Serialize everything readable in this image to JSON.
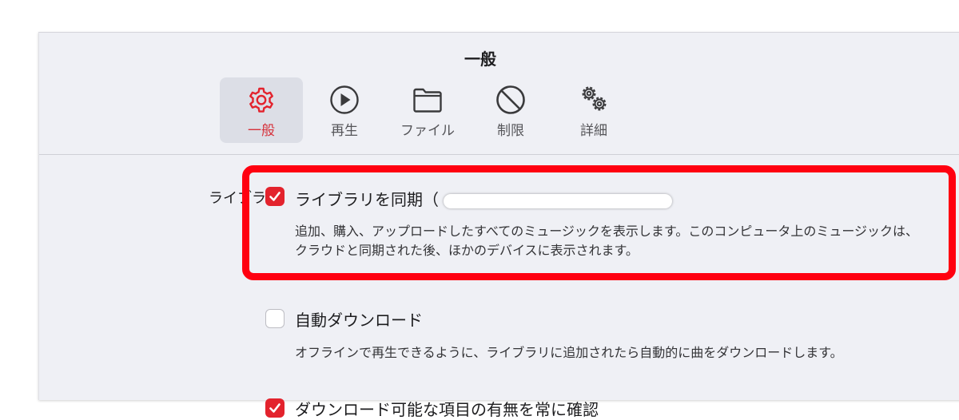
{
  "window": {
    "title": "一般"
  },
  "tabs": [
    {
      "label": "一般",
      "icon": "gear-icon",
      "active": true
    },
    {
      "label": "再生",
      "icon": "play-circle-icon",
      "active": false
    },
    {
      "label": "ファイル",
      "icon": "folder-icon",
      "active": false
    },
    {
      "label": "制限",
      "icon": "prohibited-icon",
      "active": false
    },
    {
      "label": "詳細",
      "icon": "gears-icon",
      "active": false
    }
  ],
  "library": {
    "section_label": "ライブラリ",
    "options": [
      {
        "label": "ライブラリを同期（",
        "checked": true,
        "description": "追加、購入、アップロードしたすべてのミュージックを表示します。このコンピュータ上のミュージックは、クラウドと同期された後、ほかのデバイスに表示されます。"
      },
      {
        "label": "自動ダウンロード",
        "checked": false,
        "description": "オフラインで再生できるように、ライブラリに追加されたら自動的に曲をダウンロードします。"
      },
      {
        "label": "ダウンロード可能な項目の有無を常に確認",
        "checked": true
      }
    ]
  },
  "colors": {
    "accent": "#e3232d",
    "highlight_frame": "#ff0010",
    "background": "#eff0f5"
  }
}
